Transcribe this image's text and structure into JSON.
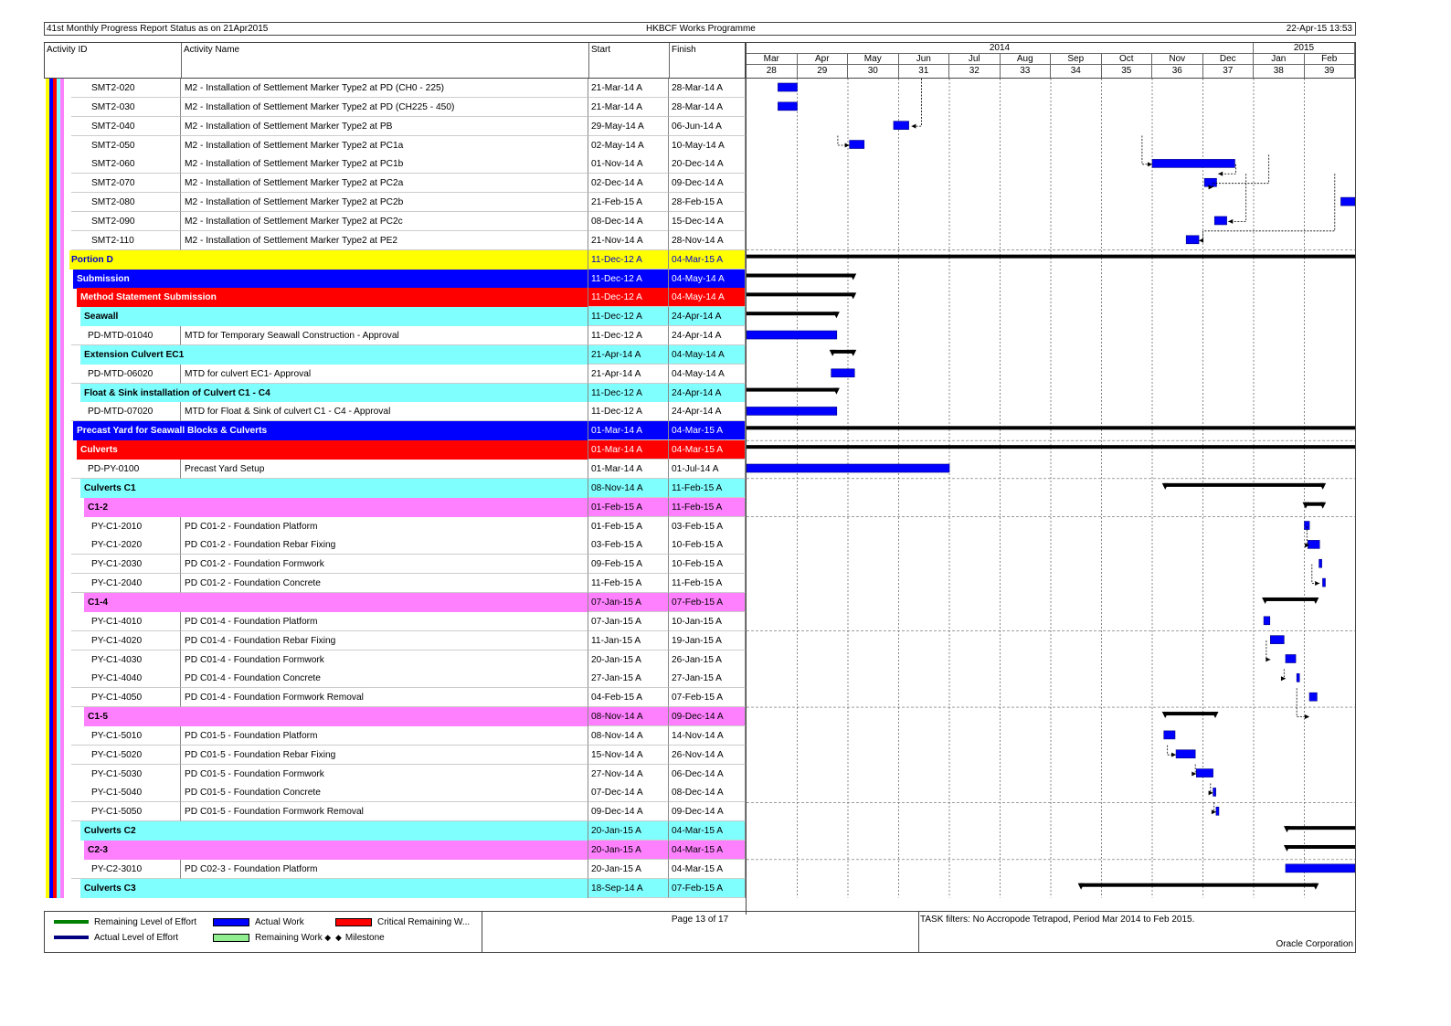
{
  "header": {
    "left": "41st Monthly Progress Report Status as on 21Apr2015",
    "center": "HKBCF Works Programme",
    "right": "22-Apr-15 13:53"
  },
  "columns": {
    "id": "Activity ID",
    "name": "Activity Name",
    "start": "Start",
    "finish": "Finish"
  },
  "timeline": {
    "years": [
      {
        "label": "2014",
        "span": 10
      },
      {
        "label": "2015",
        "span": 2
      }
    ],
    "months": [
      "Mar",
      "Apr",
      "May",
      "Jun",
      "Jul",
      "Aug",
      "Sep",
      "Oct",
      "Nov",
      "Dec",
      "Jan",
      "Feb"
    ],
    "periods": [
      "28",
      "29",
      "30",
      "31",
      "32",
      "33",
      "34",
      "35",
      "36",
      "37",
      "38",
      "39"
    ]
  },
  "colors": {
    "portion": "#ffff00",
    "wbs_blue": "#0000ff",
    "wbs_red": "#ff0000",
    "wbs_cyan": "#80ffff",
    "wbs_magenta": "#ff80ff",
    "actual_work": "#0000ff",
    "summary_bar": "#000000"
  },
  "rows": [
    {
      "type": "act",
      "id": "SMT2-020",
      "name": "M2 - Installation of Settlement Marker Type2 at PD (CH0 - 225)",
      "start": "21-Mar-14 A",
      "finish": "28-Mar-14 A",
      "bar": [
        0.62,
        1.0
      ]
    },
    {
      "type": "act",
      "id": "SMT2-030",
      "name": "M2 - Installation of Settlement Marker Type2 at PD (CH225 - 450)",
      "start": "21-Mar-14 A",
      "finish": "28-Mar-14 A",
      "bar": [
        0.62,
        1.0
      ]
    },
    {
      "type": "act",
      "id": "SMT2-040",
      "name": "M2 - Installation of Settlement Marker Type2 at PB",
      "start": "29-May-14 A",
      "finish": "06-Jun-14 A",
      "bar": [
        2.9,
        3.2
      ]
    },
    {
      "type": "act",
      "id": "SMT2-050",
      "name": "M2 - Installation of Settlement Marker Type2 at PC1a",
      "start": "02-May-14 A",
      "finish": "10-May-14 A",
      "bar": [
        2.03,
        2.32
      ]
    },
    {
      "type": "act",
      "id": "SMT2-060",
      "name": "M2 - Installation of Settlement Marker Type2 at PC1b",
      "start": "01-Nov-14 A",
      "finish": "20-Dec-14 A",
      "bar": [
        8.0,
        9.63
      ]
    },
    {
      "type": "act",
      "id": "SMT2-070",
      "name": "M2 - Installation of Settlement Marker Type2 at PC2a",
      "start": "02-Dec-14 A",
      "finish": "09-Dec-14 A",
      "bar": [
        9.03,
        9.27
      ]
    },
    {
      "type": "act",
      "id": "SMT2-080",
      "name": "M2 - Installation of Settlement Marker Type2 at PC2b",
      "start": "21-Feb-15 A",
      "finish": "28-Feb-15 A",
      "bar": [
        11.72,
        12.0
      ]
    },
    {
      "type": "act",
      "id": "SMT2-090",
      "name": "M2 - Installation of Settlement Marker Type2 at PC2c",
      "start": "08-Dec-14 A",
      "finish": "15-Dec-14 A",
      "bar": [
        9.23,
        9.47
      ]
    },
    {
      "type": "act",
      "id": "SMT2-110",
      "name": "M2 - Installation of Settlement Marker Type2 at PE2",
      "start": "21-Nov-14 A",
      "finish": "28-Nov-14 A",
      "bar": [
        8.67,
        8.92
      ]
    },
    {
      "type": "wbs",
      "level": 0,
      "color": "portion",
      "label": "Portion D",
      "start": "11-Dec-12 A",
      "finish": "04-Mar-15 A",
      "sbar": [
        0,
        12
      ]
    },
    {
      "type": "wbs",
      "level": 1,
      "color": "wbs_blue",
      "label": "Submission",
      "start": "11-Dec-12 A",
      "finish": "04-May-14 A",
      "sbar": [
        0,
        2.13
      ]
    },
    {
      "type": "wbs",
      "level": 2,
      "color": "wbs_red",
      "label": "Method Statement Submission",
      "start": "11-Dec-12 A",
      "finish": "04-May-14 A",
      "sbar": [
        0,
        2.13
      ]
    },
    {
      "type": "wbs",
      "level": 3,
      "color": "wbs_cyan",
      "label": "Seawall",
      "start": "11-Dec-12 A",
      "finish": "24-Apr-14 A",
      "sbar": [
        0,
        1.8
      ]
    },
    {
      "type": "act",
      "id": "PD-MTD-01040",
      "name": "MTD for Temporary Seawall Construction - Approval",
      "start": "11-Dec-12 A",
      "finish": "24-Apr-14 A",
      "bar": [
        0,
        1.78
      ]
    },
    {
      "type": "wbs",
      "level": 3,
      "color": "wbs_cyan",
      "label": "Extension Culvert EC1",
      "start": "21-Apr-14 A",
      "finish": "04-May-14 A",
      "sbar": [
        1.67,
        2.13
      ]
    },
    {
      "type": "act",
      "id": "PD-MTD-06020",
      "name": "MTD for culvert EC1- Approval",
      "start": "21-Apr-14 A",
      "finish": "04-May-14 A",
      "bar": [
        1.67,
        2.13
      ]
    },
    {
      "type": "wbs",
      "level": 3,
      "color": "wbs_cyan",
      "label": "Float & Sink installation of Culvert C1 - C4",
      "start": "11-Dec-12 A",
      "finish": "24-Apr-14 A",
      "sbar": [
        0,
        1.8
      ]
    },
    {
      "type": "act",
      "id": "PD-MTD-07020",
      "name": "MTD for Float & Sink of culvert C1 - C4 - Approval",
      "start": "11-Dec-12 A",
      "finish": "24-Apr-14 A",
      "bar": [
        0,
        1.78
      ]
    },
    {
      "type": "wbs",
      "level": 1,
      "color": "wbs_blue",
      "label": "Precast Yard for Seawall Blocks & Culverts",
      "start": "01-Mar-14 A",
      "finish": "04-Mar-15 A",
      "sbar": [
        0,
        12
      ]
    },
    {
      "type": "wbs",
      "level": 2,
      "color": "wbs_red",
      "label": "Culverts",
      "start": "01-Mar-14 A",
      "finish": "04-Mar-15 A",
      "sbar": [
        0,
        12
      ]
    },
    {
      "type": "act",
      "id": "PD-PY-0100",
      "name": "Precast Yard Setup",
      "start": "01-Mar-14 A",
      "finish": "01-Jul-14 A",
      "bar": [
        0,
        4.0
      ]
    },
    {
      "type": "wbs",
      "level": 3,
      "color": "wbs_cyan",
      "label": "Culverts C1",
      "start": "08-Nov-14 A",
      "finish": "11-Feb-15 A",
      "sbar": [
        8.23,
        11.39
      ]
    },
    {
      "type": "wbs",
      "level": 4,
      "color": "wbs_magenta",
      "label": "C1-2",
      "start": "01-Feb-15 A",
      "finish": "11-Feb-15 A",
      "sbar": [
        11.0,
        11.39
      ]
    },
    {
      "type": "act",
      "id": "PY-C1-2010",
      "name": "PD C01-2 - Foundation Platform",
      "start": "01-Feb-15 A",
      "finish": "03-Feb-15 A",
      "bar": [
        11.0,
        11.1
      ]
    },
    {
      "type": "act",
      "id": "PY-C1-2020",
      "name": "PD C01-2 - Foundation Rebar Fixing",
      "start": "03-Feb-15 A",
      "finish": "10-Feb-15 A",
      "bar": [
        11.07,
        11.3
      ]
    },
    {
      "type": "act",
      "id": "PY-C1-2030",
      "name": "PD C01-2 - Foundation Formwork",
      "start": "09-Feb-15 A",
      "finish": "10-Feb-15 A",
      "bar": [
        11.29,
        11.33
      ]
    },
    {
      "type": "act",
      "id": "PY-C1-2040",
      "name": "PD C01-2 - Foundation Concrete",
      "start": "11-Feb-15 A",
      "finish": "11-Feb-15 A",
      "bar": [
        11.36,
        11.39
      ]
    },
    {
      "type": "wbs",
      "level": 4,
      "color": "wbs_magenta",
      "label": "C1-4",
      "start": "07-Jan-15 A",
      "finish": "07-Feb-15 A",
      "sbar": [
        10.2,
        11.25
      ]
    },
    {
      "type": "act",
      "id": "PY-C1-4010",
      "name": "PD C01-4 - Foundation Platform",
      "start": "07-Jan-15 A",
      "finish": "10-Jan-15 A",
      "bar": [
        10.2,
        10.32
      ]
    },
    {
      "type": "act",
      "id": "PY-C1-4020",
      "name": "PD C01-4 - Foundation Rebar Fixing",
      "start": "11-Jan-15 A",
      "finish": "19-Jan-15 A",
      "bar": [
        10.33,
        10.6
      ]
    },
    {
      "type": "act",
      "id": "PY-C1-4030",
      "name": "PD C01-4 - Foundation Formwork",
      "start": "20-Jan-15 A",
      "finish": "26-Jan-15 A",
      "bar": [
        10.63,
        10.83
      ]
    },
    {
      "type": "act",
      "id": "PY-C1-4040",
      "name": "PD C01-4 - Foundation Concrete",
      "start": "27-Jan-15 A",
      "finish": "27-Jan-15 A",
      "bar": [
        10.85,
        10.9
      ]
    },
    {
      "type": "act",
      "id": "PY-C1-4050",
      "name": "PD C01-4 - Foundation Formwork Removal",
      "start": "04-Feb-15 A",
      "finish": "07-Feb-15 A",
      "bar": [
        11.1,
        11.25
      ]
    },
    {
      "type": "wbs",
      "level": 4,
      "color": "wbs_magenta",
      "label": "C1-5",
      "start": "08-Nov-14 A",
      "finish": "09-Dec-14 A",
      "sbar": [
        8.23,
        9.27
      ]
    },
    {
      "type": "act",
      "id": "PY-C1-5010",
      "name": "PD C01-5 - Foundation Platform",
      "start": "08-Nov-14 A",
      "finish": "14-Nov-14 A",
      "bar": [
        8.23,
        8.45
      ]
    },
    {
      "type": "act",
      "id": "PY-C1-5020",
      "name": "PD C01-5 - Foundation Rebar Fixing",
      "start": "15-Nov-14 A",
      "finish": "26-Nov-14 A",
      "bar": [
        8.47,
        8.85
      ]
    },
    {
      "type": "act",
      "id": "PY-C1-5030",
      "name": "PD C01-5 - Foundation Formwork",
      "start": "27-Nov-14 A",
      "finish": "06-Dec-14 A",
      "bar": [
        8.87,
        9.2
      ]
    },
    {
      "type": "act",
      "id": "PY-C1-5040",
      "name": "PD C01-5 - Foundation Concrete",
      "start": "07-Dec-14 A",
      "finish": "08-Dec-14 A",
      "bar": [
        9.2,
        9.25
      ]
    },
    {
      "type": "act",
      "id": "PY-C1-5050",
      "name": "PD C01-5 - Foundation Formwork Removal",
      "start": "09-Dec-14 A",
      "finish": "09-Dec-14 A",
      "bar": [
        9.26,
        9.29
      ]
    },
    {
      "type": "wbs",
      "level": 3,
      "color": "wbs_cyan",
      "label": "Culverts C2",
      "start": "20-Jan-15 A",
      "finish": "04-Mar-15 A",
      "sbar": [
        10.63,
        12
      ]
    },
    {
      "type": "wbs",
      "level": 4,
      "color": "wbs_magenta",
      "label": "C2-3",
      "start": "20-Jan-15 A",
      "finish": "04-Mar-15 A",
      "sbar": [
        10.63,
        12
      ]
    },
    {
      "type": "act",
      "id": "PY-C2-3010",
      "name": "PD C02-3 - Foundation Platform",
      "start": "20-Jan-15 A",
      "finish": "04-Mar-15 A",
      "bar": [
        10.63,
        12
      ]
    },
    {
      "type": "wbs",
      "level": 3,
      "color": "wbs_cyan",
      "label": "Culverts C3",
      "start": "18-Sep-14 A",
      "finish": "07-Feb-15 A",
      "sbar": [
        6.57,
        11.25
      ]
    }
  ],
  "footer": {
    "legend": [
      {
        "label": "Remaining Level of Effort",
        "color": "#008000",
        "kind": "line"
      },
      {
        "label": "Actual Work",
        "color": "#0000ff",
        "kind": "bar"
      },
      {
        "label": "Critical Remaining W...",
        "color": "#ff0000",
        "kind": "bar"
      },
      {
        "label": "Actual Level of Effort",
        "color": "#000080",
        "kind": "line"
      },
      {
        "label": "Remaining Work",
        "color": "#90ee90",
        "kind": "bar"
      },
      {
        "label": "Milestone",
        "color": "#000000",
        "kind": "diamond"
      }
    ],
    "page": "Page 13 of 17",
    "filters": "TASK filters: No Accropode Tetrapod, Period Mar 2014 to Feb 2015.",
    "company": "Oracle Corporation"
  }
}
